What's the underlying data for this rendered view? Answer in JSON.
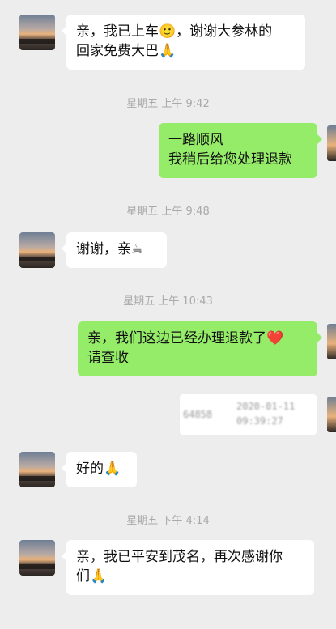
{
  "messages": [
    {
      "id": "m1",
      "text": "亲，我已上车🙂，谢谢大参林的\n回家免费大巴🙏"
    },
    {
      "id": "t1",
      "time": "星期五 上午 9:42"
    },
    {
      "id": "m2",
      "text": "一路顺风\n我稍后给您处理退款"
    },
    {
      "id": "t2",
      "time": "星期五 上午 9:48"
    },
    {
      "id": "m3",
      "text": "谢谢，亲☕"
    },
    {
      "id": "t3",
      "time": "星期五 上午 10:43"
    },
    {
      "id": "m4",
      "text": "亲，我们这边已经办理退款了❤️\n请查收"
    },
    {
      "id": "m5",
      "card": {
        "code": "64858",
        "date": "2020-01-11",
        "clock": "09:39:27"
      }
    },
    {
      "id": "m6",
      "text": "好的🙏"
    },
    {
      "id": "t4",
      "time": "星期五 下午 4:14"
    },
    {
      "id": "m7",
      "text": "亲，我已平安到茂名，再次感谢你\n们🙏"
    }
  ]
}
